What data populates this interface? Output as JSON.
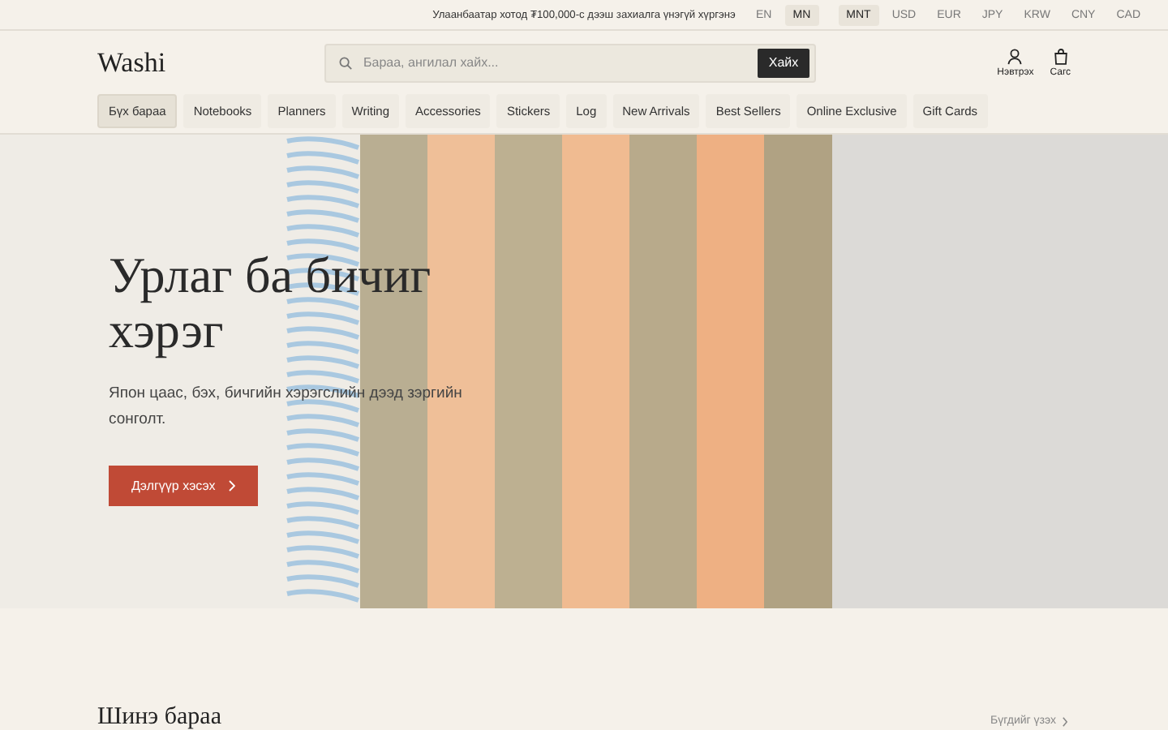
{
  "announcement": "Улаанбаатар хотод ₮100,000-с дээш захиалга үнэгүй хүргэнэ",
  "languages": [
    {
      "label": "EN",
      "selected": false
    },
    {
      "label": "MN",
      "selected": true
    }
  ],
  "currencies": [
    {
      "label": "MNT",
      "selected": true
    },
    {
      "label": "USD",
      "selected": false
    },
    {
      "label": "EUR",
      "selected": false
    },
    {
      "label": "JPY",
      "selected": false
    },
    {
      "label": "KRW",
      "selected": false
    },
    {
      "label": "CNY",
      "selected": false
    },
    {
      "label": "CAD",
      "selected": false
    }
  ],
  "header": {
    "logo": "Washi",
    "search": {
      "placeholder": "Бараа, ангилал хайх...",
      "button": "Хайх"
    },
    "actions": [
      {
        "kind": "account",
        "label": "Нэвтрэх"
      },
      {
        "kind": "cart",
        "label": "Сагс"
      }
    ]
  },
  "nav": [
    {
      "label": "Бүх бараа",
      "selected": true
    },
    {
      "label": "Notebooks",
      "selected": false
    },
    {
      "label": "Planners",
      "selected": false
    },
    {
      "label": "Writing",
      "selected": false
    },
    {
      "label": "Accessories",
      "selected": false
    },
    {
      "label": "Stickers",
      "selected": false
    },
    {
      "label": "Log",
      "selected": false
    },
    {
      "label": "New Arrivals",
      "selected": false
    },
    {
      "label": "Best Sellers",
      "selected": false
    },
    {
      "label": "Online Exclusive",
      "selected": false
    },
    {
      "label": "Gift Cards",
      "selected": false
    }
  ],
  "hero": {
    "title": "Урлаг ба бичиг хэрэг",
    "subtitle": "Япон цаас, бэх, бичгийн хэрэгслийн дээд зэргийн сонголт.",
    "button": "Дэлгүүр хэсэх"
  },
  "section": {
    "title": "Шинэ бараа",
    "link": "Бүгдийг үзэх"
  }
}
